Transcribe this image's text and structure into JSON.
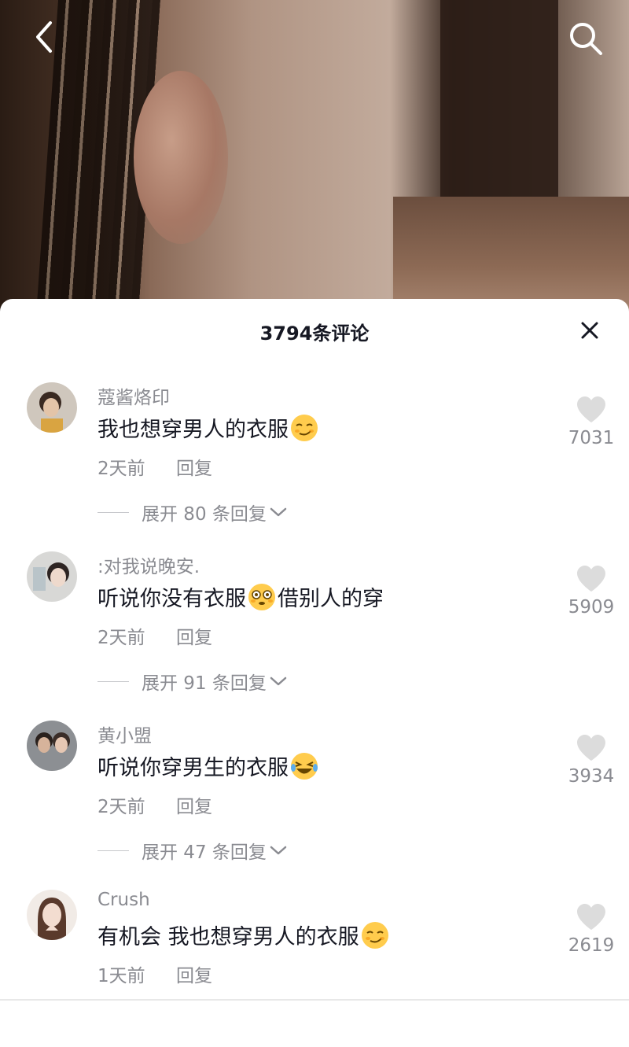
{
  "header": {
    "title": "3794条评论"
  },
  "comments": [
    {
      "username": "蔻酱烙印",
      "text_parts": [
        "我也想穿男人的衣服",
        ""
      ],
      "emoji": "smirk-emoji",
      "time": "2天前",
      "reply_label": "回复",
      "expand_label": "展开 80 条回复",
      "likes": "7031"
    },
    {
      "username": ":对我说晚安.",
      "text_parts": [
        "听说你没有衣服",
        "借别人的穿"
      ],
      "emoji": "flushed-emoji",
      "time": "2天前",
      "reply_label": "回复",
      "expand_label": "展开 91 条回复",
      "likes": "5909"
    },
    {
      "username": "黄小盟",
      "text_parts": [
        "听说你穿男生的衣服",
        ""
      ],
      "emoji": "laughing-tears-emoji",
      "time": "2天前",
      "reply_label": "回复",
      "expand_label": "展开 47 条回复",
      "likes": "3934"
    },
    {
      "username": "Crush",
      "text_parts": [
        "有机会 我也想穿男人的衣服",
        ""
      ],
      "emoji": "smirk-emoji",
      "time": "1天前",
      "reply_label": "回复",
      "expand_label": "",
      "likes": "2619"
    }
  ],
  "colors": {
    "text_primary": "#161823",
    "text_secondary": "#8a8b91",
    "heart_gray": "#dcdcdc"
  }
}
